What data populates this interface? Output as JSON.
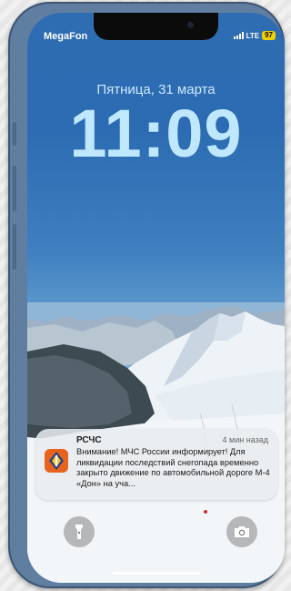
{
  "status_bar": {
    "carrier": "MegaFon",
    "network": "LTE",
    "battery": "97",
    "signal_bars": 4
  },
  "lock_screen": {
    "date": "Пятница, 31 марта",
    "time": "11:09"
  },
  "notification": {
    "app": "РСЧС",
    "time_ago": "4 мин назад",
    "body": "Внимание! МЧС России информирует! Для ликвидации последствий снегопада временно закрыто движение по автомобильной дороге М-4 «Дон» на уча..."
  },
  "quick_actions": {
    "left_icon": "flashlight-icon",
    "right_icon": "camera-icon"
  },
  "colors": {
    "phone_frame": "#5f7ea0",
    "clock": "#bfe8ff",
    "battery_badge": "#f3d000",
    "app_icon": "#e8641e"
  }
}
